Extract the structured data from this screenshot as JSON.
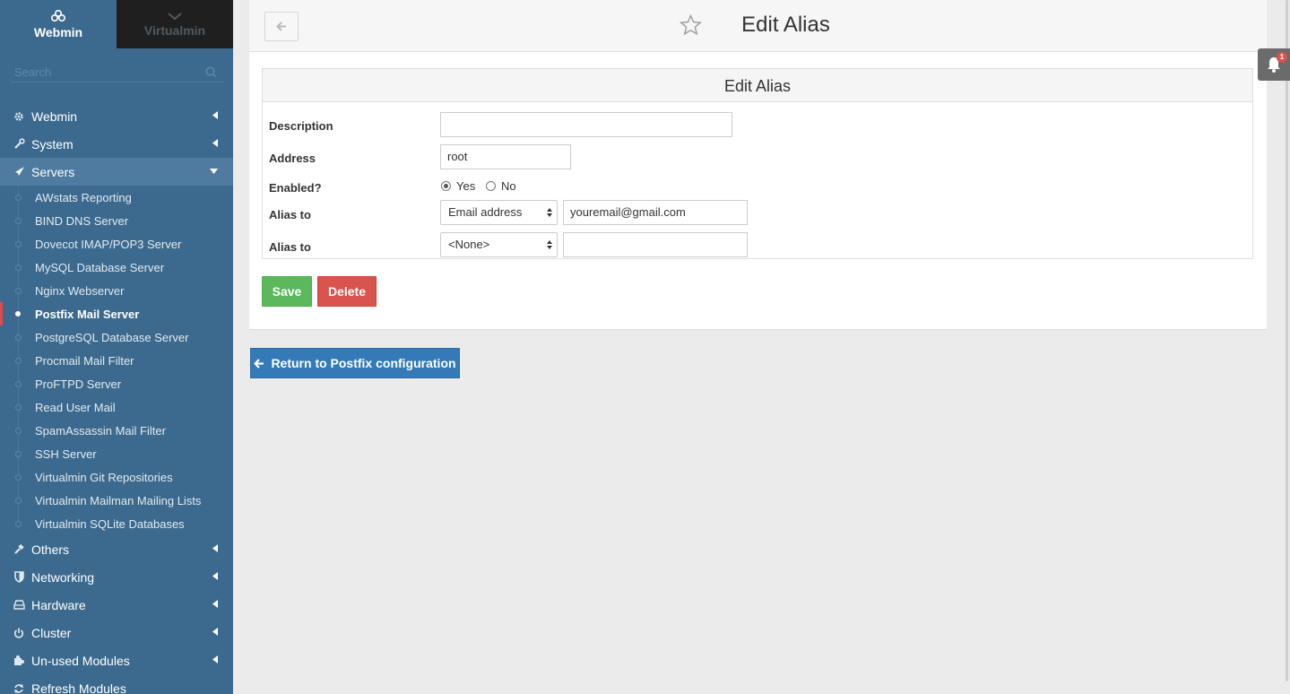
{
  "sidebar": {
    "tabs": [
      {
        "label": "Webmin",
        "active": true
      },
      {
        "label": "Virtualmin",
        "active": false
      }
    ],
    "search_placeholder": "Search",
    "categories_top": [
      {
        "label": "Webmin",
        "icon": "gear-icon"
      },
      {
        "label": "System",
        "icon": "wrench-icon"
      }
    ],
    "open_category": {
      "label": "Servers",
      "icon": "rocket-icon"
    },
    "server_items": [
      "AWstats Reporting",
      "BIND DNS Server",
      "Dovecot IMAP/POP3 Server",
      "MySQL Database Server",
      "Nginx Webserver",
      "Postfix Mail Server",
      "PostgreSQL Database Server",
      "Procmail Mail Filter",
      "ProFTPD Server",
      "Read User Mail",
      "SpamAssassin Mail Filter",
      "SSH Server",
      "Virtualmin Git Repositories",
      "Virtualmin Mailman Mailing Lists",
      "Virtualmin SQLite Databases"
    ],
    "active_server_item": "Postfix Mail Server",
    "categories_bottom": [
      {
        "label": "Others",
        "icon": "tools-icon"
      },
      {
        "label": "Networking",
        "icon": "shield-icon"
      },
      {
        "label": "Hardware",
        "icon": "hdd-icon"
      },
      {
        "label": "Cluster",
        "icon": "power-icon"
      },
      {
        "label": "Un-used Modules",
        "icon": "puzzle-icon"
      },
      {
        "label": "Refresh Modules",
        "icon": "refresh-icon"
      }
    ]
  },
  "header": {
    "title": "Edit Alias"
  },
  "form": {
    "heading": "Edit Alias",
    "description_label": "Description",
    "description_value": "",
    "address_label": "Address",
    "address_value": "root",
    "enabled_label": "Enabled?",
    "enabled_yes": "Yes",
    "enabled_no": "No",
    "enabled_selected": "Yes",
    "alias1_label": "Alias to",
    "alias1_type": "Email address",
    "alias1_value": "youremail@gmail.com",
    "alias2_label": "Alias to",
    "alias2_type": "<None>",
    "alias2_value": ""
  },
  "buttons": {
    "save": "Save",
    "delete": "Delete",
    "return": "Return to Postfix configuration"
  },
  "notifications": {
    "count": "1"
  },
  "colors": {
    "sidebar": "#3c6a8e",
    "save": "#5cb85c",
    "delete": "#d9534f",
    "return": "#337ab7"
  }
}
